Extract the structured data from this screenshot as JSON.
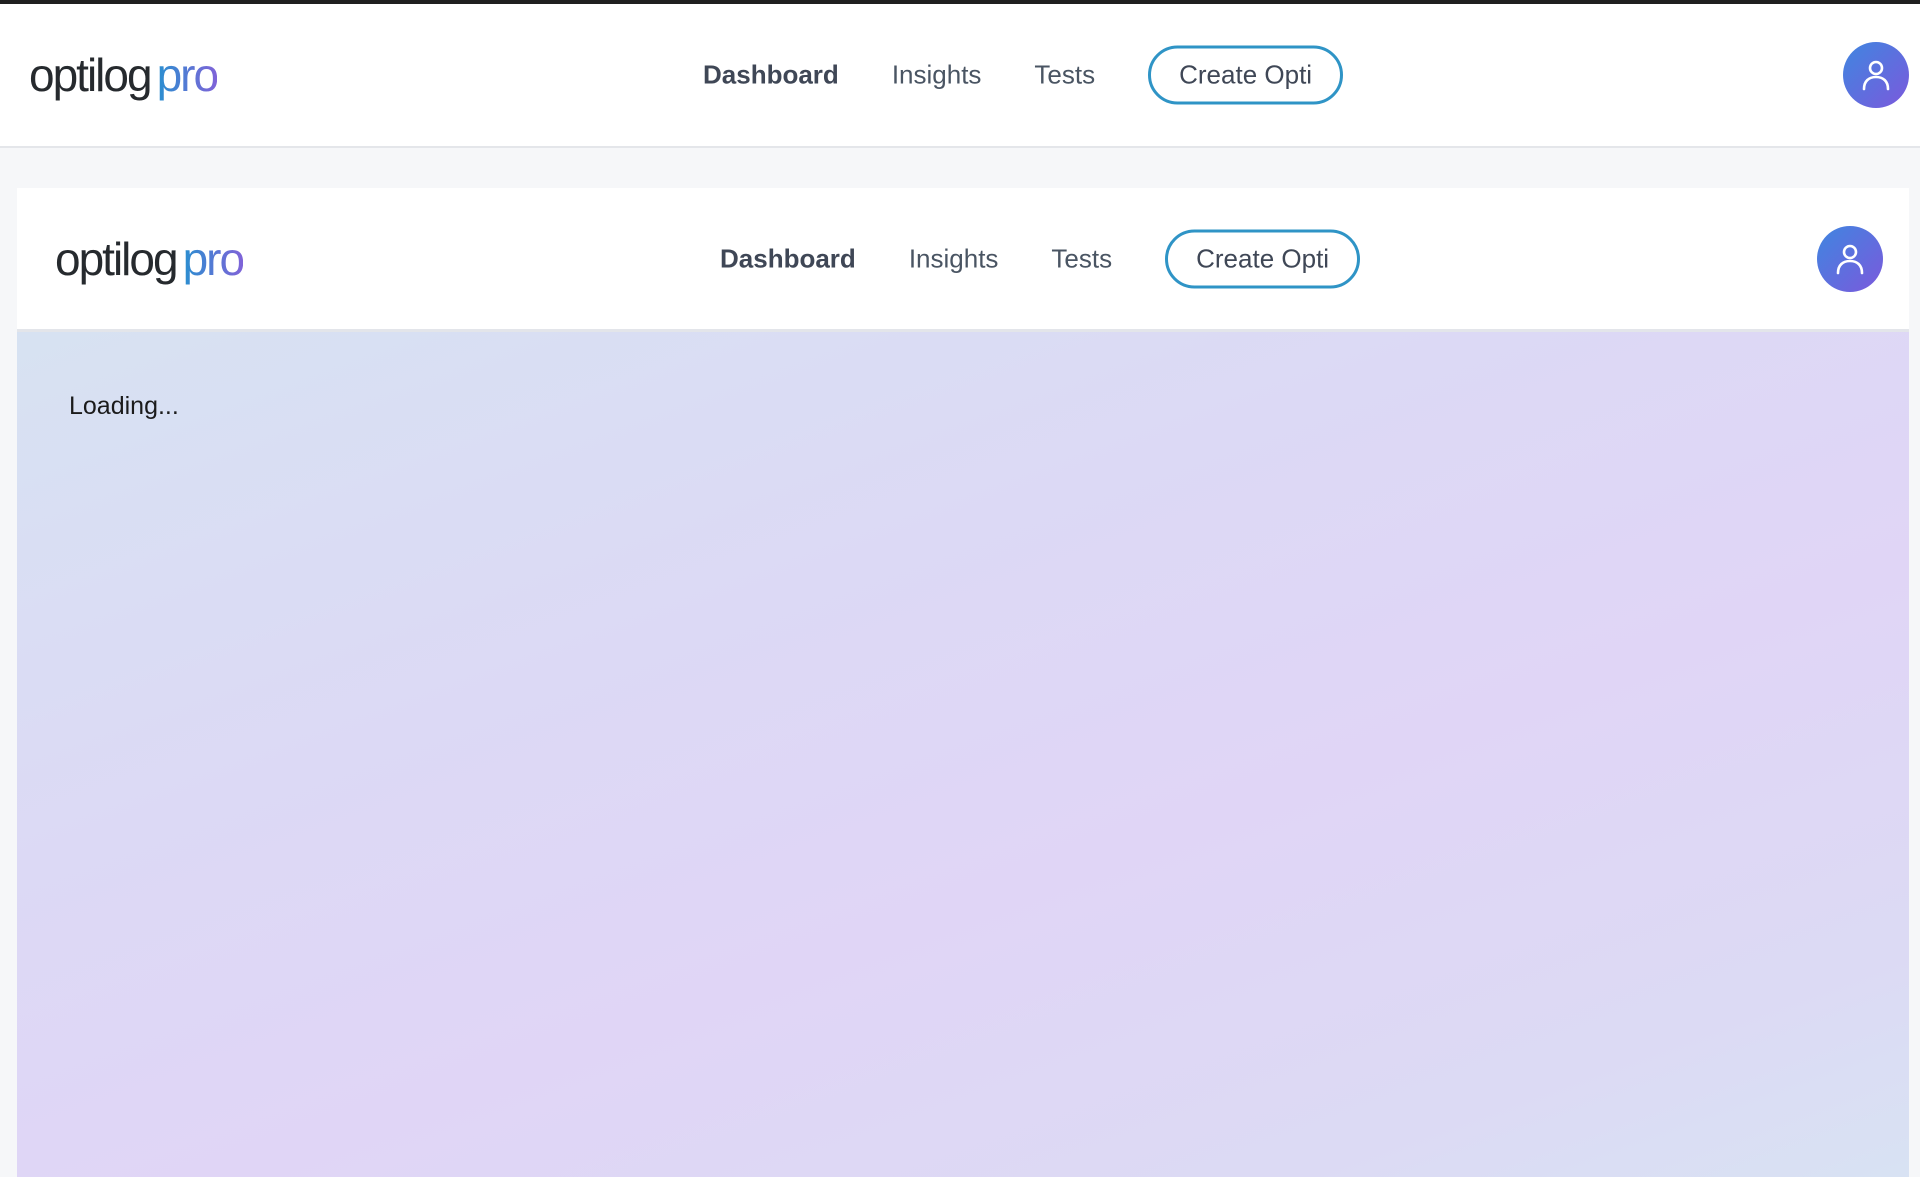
{
  "app": {
    "logo_word": "optilog",
    "logo_accent": "pro"
  },
  "nav": {
    "items": [
      {
        "label": "Dashboard",
        "active": true
      },
      {
        "label": "Insights",
        "active": false
      },
      {
        "label": "Tests",
        "active": false
      }
    ],
    "create_label": "Create Opti",
    "avatar_icon": "user-icon"
  },
  "main": {
    "status_text": "Loading..."
  },
  "colors": {
    "accent_border": "#2f94c6",
    "avatar_gradient_start": "#3f86e0",
    "avatar_gradient_end": "#7b59dc",
    "content_gradient_start": "#d7e2f2",
    "content_gradient_end": "#e0d5f6"
  }
}
